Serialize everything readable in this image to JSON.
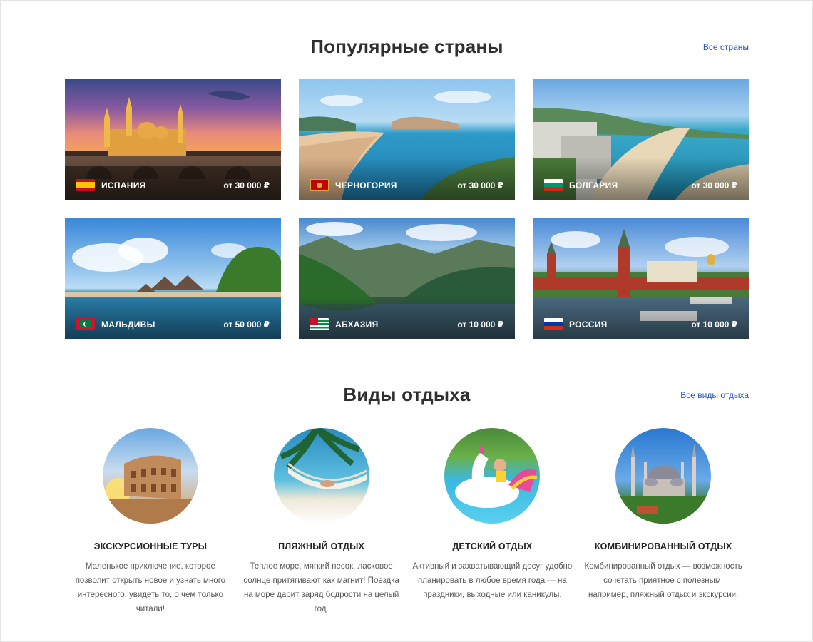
{
  "popular": {
    "title": "Популярные страны",
    "all_link": "Все страны",
    "countries": [
      {
        "name": "ИСПАНИЯ",
        "price": "от 30 000 ₽"
      },
      {
        "name": "ЧЕРНОГОРИЯ",
        "price": "от 30 000 ₽"
      },
      {
        "name": "БОЛГАРИЯ",
        "price": "от 30 000 ₽"
      },
      {
        "name": "МАЛЬДИВЫ",
        "price": "от 50 000 ₽"
      },
      {
        "name": "АБХАЗИЯ",
        "price": "от 10 000 ₽"
      },
      {
        "name": "РОССИЯ",
        "price": "от 10 000 ₽"
      }
    ]
  },
  "types": {
    "title": "Виды отдыха",
    "all_link": "Все виды отдыха",
    "items": [
      {
        "title": "ЭКСКУРСИОННЫЕ ТУРЫ",
        "desc": "Маленькое приключение, которое позволит открыть новое и узнать много интересного, увидеть то, о чем только читали!"
      },
      {
        "title": "ПЛЯЖНЫЙ ОТДЫХ",
        "desc": "Теплое море, мягкий песок, ласковое солнце притягивают как магнит! Поездка на море дарит заряд бодрости на целый год."
      },
      {
        "title": "ДЕТСКИЙ ОТДЫХ",
        "desc": "Активный и захватывающий досуг удобно планировать в любое время года — на праздники, выходные или каникулы."
      },
      {
        "title": "КОМБИНИРОВАННЫЙ ОТДЫХ",
        "desc": "Комбинированный отдых — возможность сочетать приятное с полезным, например, пляжный отдых и экскурсии."
      }
    ]
  }
}
